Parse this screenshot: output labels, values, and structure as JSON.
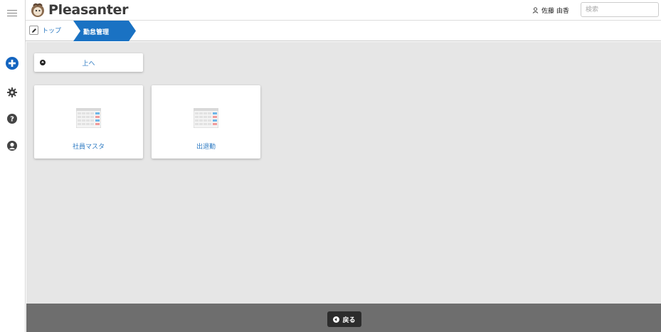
{
  "header": {
    "app_name": "Pleasanter",
    "user_name": "佐藤 由香",
    "search_placeholder": "検索"
  },
  "breadcrumb": {
    "home_label": "トップ",
    "current_label": "勤怠管理"
  },
  "main": {
    "up_label": "上へ",
    "tiles": [
      {
        "label": "社員マスタ",
        "icon": "table-icon"
      },
      {
        "label": "出退勤",
        "icon": "table-icon"
      }
    ]
  },
  "footer": {
    "back_label": "戻る"
  },
  "rail": {
    "icons": [
      "menu-icon",
      "add-icon",
      "gear-icon",
      "help-icon",
      "user-icon"
    ]
  },
  "colors": {
    "accent": "#2b79c2",
    "breadcrumb_active": "#1a72c3",
    "main_bg": "#e6e6e6",
    "footer_bg": "#6e6e6e"
  }
}
